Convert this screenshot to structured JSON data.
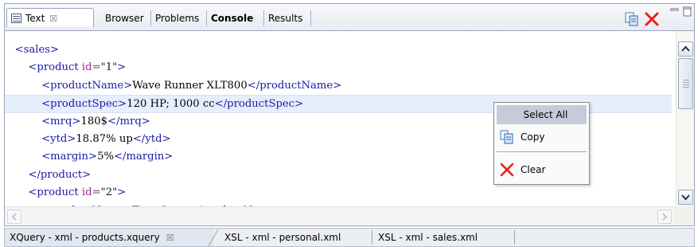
{
  "tabs": [
    {
      "label": "Text",
      "closable": true,
      "active": true
    },
    {
      "label": "Browser",
      "active": false
    },
    {
      "label": "Problems",
      "active": false
    },
    {
      "label": "Console",
      "active": false,
      "bold": true
    },
    {
      "label": "Results",
      "active": false
    }
  ],
  "close_glyph": "☒",
  "toolbar": {
    "copy_icon": "copy-icon",
    "clear_icon": "clear-icon",
    "minimize_icon": "minimize-icon",
    "maximize_icon": "maximize-icon"
  },
  "code_lines": [
    {
      "indent": "",
      "tag_open": "<sales>",
      "attr": "",
      "val": "",
      "text": "",
      "tag_close": ""
    },
    {
      "indent": "    ",
      "tag_open": "<product ",
      "attr": "id=",
      "val": "\"1\"",
      "text": "",
      "tag_close": ">"
    },
    {
      "indent": "        ",
      "tag_open": "<productName>",
      "attr": "",
      "val": "",
      "text": "Wave Runner XLT800",
      "tag_close": "</productName>"
    },
    {
      "indent": "        ",
      "tag_open": "<productSpec>",
      "attr": "",
      "val": "",
      "text": "120 HP; 1000 cc",
      "tag_close": "</productSpec>"
    },
    {
      "indent": "        ",
      "tag_open": "<mrq>",
      "attr": "",
      "val": "",
      "text": "180$",
      "tag_close": "</mrq>"
    },
    {
      "indent": "        ",
      "tag_open": "<ytd>",
      "attr": "",
      "val": "",
      "text": "18.87% up",
      "tag_close": "</ytd>"
    },
    {
      "indent": "        ",
      "tag_open": "<margin>",
      "attr": "",
      "val": "",
      "text": "5%",
      "tag_close": "</margin>"
    },
    {
      "indent": "    ",
      "tag_open": "</product>",
      "attr": "",
      "val": "",
      "text": "",
      "tag_close": ""
    },
    {
      "indent": "    ",
      "tag_open": "<product ",
      "attr": "id=",
      "val": "\"2\"",
      "text": "",
      "tag_close": ">"
    },
    {
      "indent": "        ",
      "tag_open": "<productName>",
      "attr": "",
      "val": "",
      "text": "Tour Sport",
      "tag_close": "</productName>"
    }
  ],
  "current_line": 3,
  "context_menu": {
    "select_all": "Select All",
    "copy": "Copy",
    "clear": "Clear"
  },
  "bottom_tabs": [
    {
      "label": "XQuery - xml - products.xquery",
      "closable": true,
      "active": true
    },
    {
      "label": "XSL - xml - personal.xml",
      "active": false
    },
    {
      "label": "XSL - xml - sales.xml",
      "active": false
    }
  ],
  "colors": {
    "tag": "#1a1aa6",
    "attribute": "#9b2a9b",
    "clear_x": "#e8231b",
    "menu_highlight": "#c4cbd9"
  }
}
